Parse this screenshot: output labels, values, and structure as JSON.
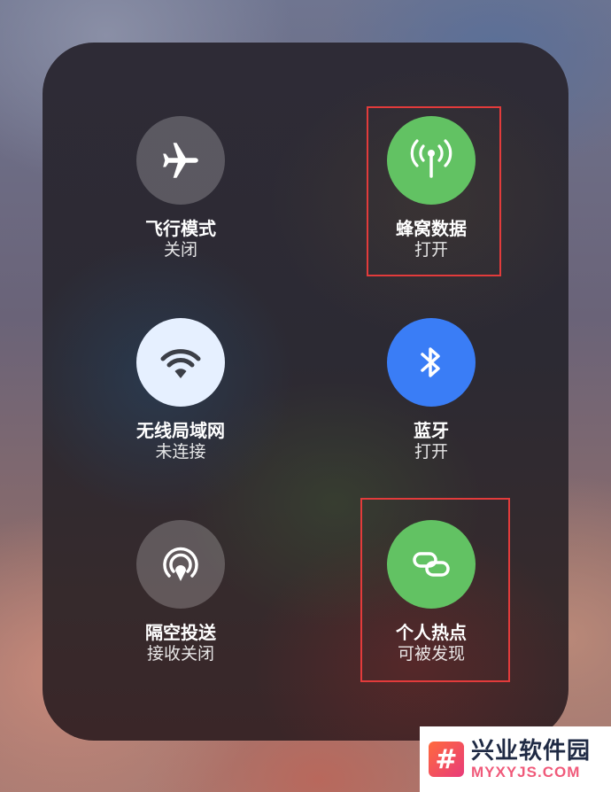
{
  "tiles": {
    "airplane": {
      "title": "飞行模式",
      "status": "关闭",
      "icon": "airplane-icon"
    },
    "cellular": {
      "title": "蜂窝数据",
      "status": "打开",
      "icon": "antenna-icon",
      "color": "#62c263"
    },
    "wifi": {
      "title": "无线局域网",
      "status": "未连接",
      "icon": "wifi-icon"
    },
    "bluetooth": {
      "title": "蓝牙",
      "status": "打开",
      "icon": "bluetooth-icon",
      "color": "#3a7df6"
    },
    "airdrop": {
      "title": "隔空投送",
      "status": "接收关闭",
      "icon": "airdrop-icon"
    },
    "hotspot": {
      "title": "个人热点",
      "status": "可被发现",
      "icon": "link-icon",
      "color": "#62c263"
    }
  },
  "annotation_color": "#e23b3b",
  "watermark": {
    "cn": "兴业软件园",
    "en": "MYXYJS.COM",
    "glyph": "#"
  }
}
